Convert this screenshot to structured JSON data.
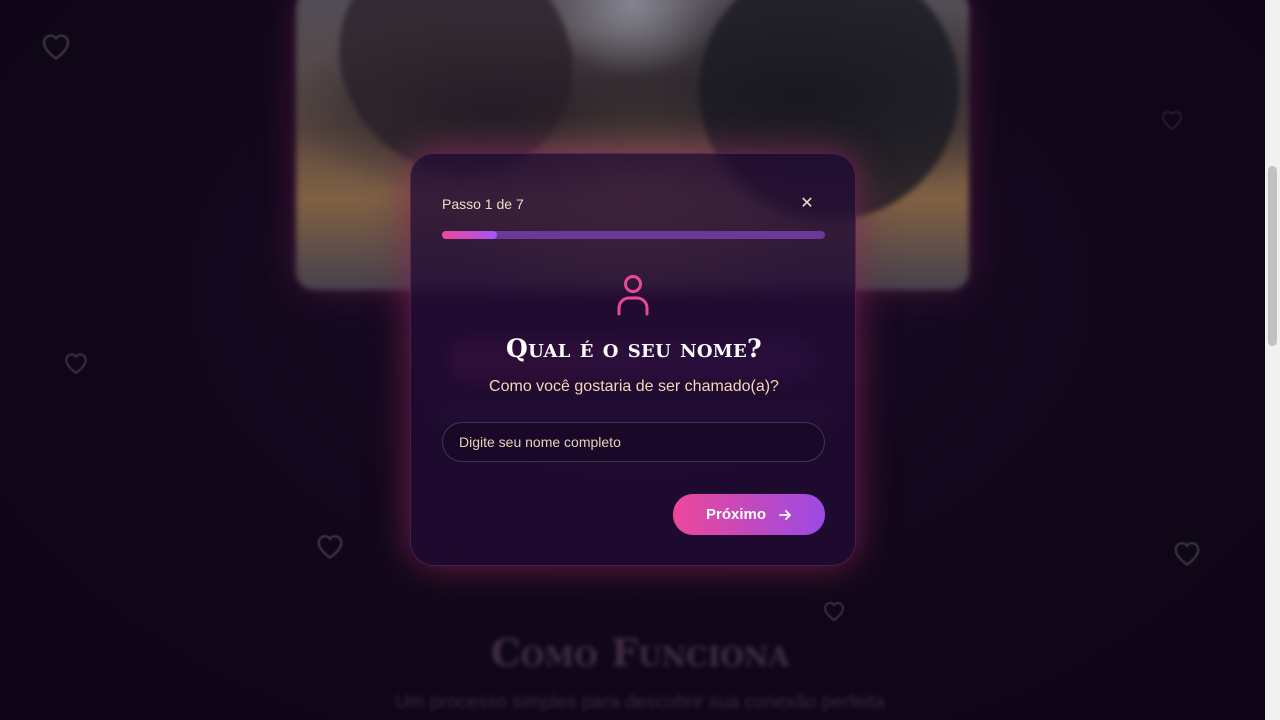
{
  "background": {
    "section_heading": "Como Funciona",
    "section_subtitle": "Um processo simples para descobrir sua conexão perfeita"
  },
  "modal": {
    "step_label": "Passo 1 de 7",
    "close_icon": "close-icon",
    "close_glyph": "✕",
    "progress": {
      "current": 1,
      "total": 7,
      "fraction": 0.1429
    },
    "icon": "user-icon",
    "question": "Qual é o seu nome?",
    "subtitle": "Como você gostaria de ser chamado(a)?",
    "name_input": {
      "placeholder": "Digite seu nome completo",
      "value": ""
    },
    "next_button": {
      "label": "Próximo",
      "icon": "arrow-right-icon"
    }
  },
  "colors": {
    "accent_pink": "#ec4899",
    "accent_purple": "#a855f7",
    "text_warm": "#f4d9b4",
    "background": "#15091f"
  }
}
